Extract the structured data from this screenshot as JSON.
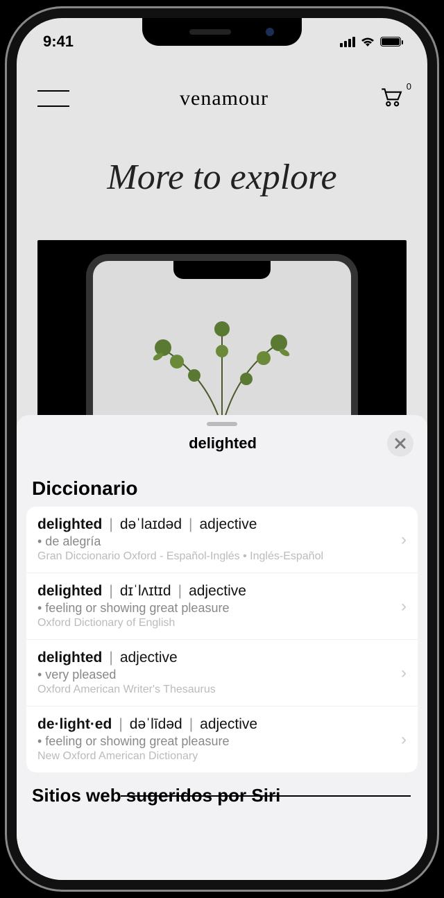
{
  "status": {
    "time": "9:41"
  },
  "header": {
    "brand": "venamour",
    "cart_count": "0"
  },
  "hero": {
    "title": "More to explore"
  },
  "sheet": {
    "title": "delighted",
    "section_label": "Diccionario",
    "entries": [
      {
        "word": "delighted",
        "pron": "dəˈlaɪdəd",
        "pos": "adjective",
        "def": "• de alegría",
        "source": "Gran Diccionario Oxford - Español-Inglés • Inglés-Español"
      },
      {
        "word": "delighted",
        "pron": "dɪˈlʌɪtɪd",
        "pos": "adjective",
        "def": "• feeling or showing great pleasure",
        "source": "Oxford Dictionary of English"
      },
      {
        "word": "delighted",
        "pron": "",
        "pos": "adjective",
        "def": "• very pleased",
        "source": "Oxford American Writer's Thesaurus"
      },
      {
        "word": "de·light·ed",
        "pron": "dəˈlīdəd",
        "pos": "adjective",
        "def": "• feeling or showing great pleasure",
        "source": "New Oxford American Dictionary"
      }
    ],
    "siri_label": "Sitios web sugeridos por Siri"
  }
}
